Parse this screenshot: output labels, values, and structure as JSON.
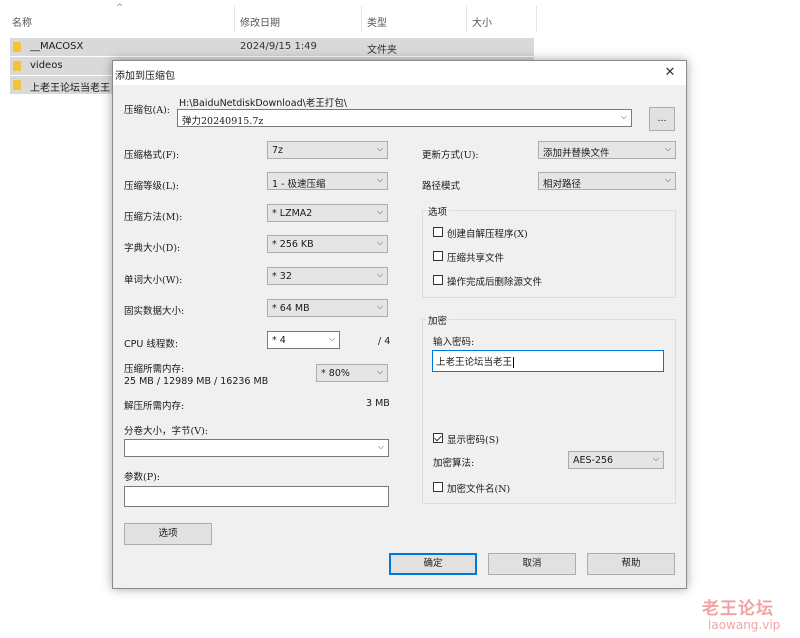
{
  "explorer": {
    "columns": {
      "name": "名称",
      "date": "修改日期",
      "type": "类型",
      "size": "大小"
    },
    "sort_indicator": "^",
    "files": [
      {
        "name": "__MACOSX",
        "date": "2024/9/15 1:49",
        "type": "文件夹"
      },
      {
        "name": "videos",
        "date": "",
        "type": ""
      },
      {
        "name": "上老王论坛当老王",
        "date": "",
        "type": ""
      }
    ]
  },
  "dialog": {
    "title": "添加到压缩包",
    "close_glyph": "✕",
    "archive_label": "压缩包(A):",
    "archive_path": "H:\\BaiduNetdiskDownload\\老王打包\\",
    "archive_name": "弹力20240915.7z",
    "browse_label": "...",
    "format": {
      "label": "压缩格式(F):",
      "value": "7z"
    },
    "level": {
      "label": "压缩等级(L):",
      "value": "1 - 极速压缩"
    },
    "method": {
      "label": "压缩方法(M):",
      "value": "* LZMA2"
    },
    "dict": {
      "label": "字典大小(D):",
      "value": "* 256 KB"
    },
    "word": {
      "label": "单词大小(W):",
      "value": "* 32"
    },
    "solid": {
      "label": "固实数据大小:",
      "value": "* 64 MB"
    },
    "cpu": {
      "label": "CPU 线程数:",
      "value": "* 4",
      "max": "/ 4"
    },
    "mem_compress": {
      "label": "压缩所需内存:",
      "detail": "25 MB / 12989 MB / 16236 MB",
      "value": "* 80%"
    },
    "mem_decompress": {
      "label": "解压所需内存:",
      "value": "3 MB"
    },
    "split": {
      "label": "分卷大小，字节(V):",
      "value": ""
    },
    "params": {
      "label": "参数(P):",
      "value": ""
    },
    "options_button": "选项",
    "update": {
      "label": "更新方式(U):",
      "value": "添加并替换文件"
    },
    "path_mode": {
      "label": "路径模式",
      "value": "相对路径"
    },
    "options_group": {
      "title": "选项",
      "sfx": "创建自解压程序(X)",
      "shared": "压缩共享文件",
      "delete": "操作完成后删除源文件"
    },
    "encrypt_group": {
      "title": "加密",
      "pwd_label": "输入密码:",
      "pwd_value": "上老王论坛当老王",
      "show_pwd": "显示密码(S)",
      "algo_label": "加密算法:",
      "algo_value": "AES-256",
      "encrypt_names": "加密文件名(N)"
    },
    "ok": "确定",
    "cancel": "取消",
    "help": "帮助"
  },
  "watermark": {
    "main": "老王论坛",
    "sub": "laowang.vip"
  }
}
